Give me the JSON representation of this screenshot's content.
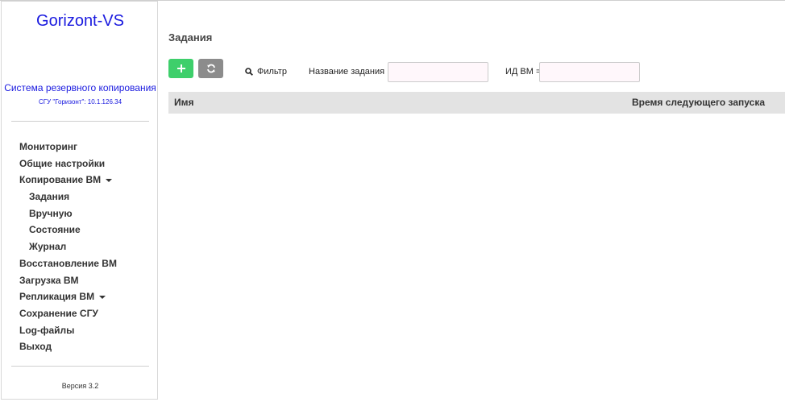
{
  "sidebar": {
    "brand": "Gorizont-VS",
    "subtitle": "Система резервного копирования",
    "host_line": "СГУ \"Горизонт\": 10.1.126.34",
    "menu": [
      {
        "label": "Мониторинг"
      },
      {
        "label": "Общие настройки"
      },
      {
        "label": "Копирование ВМ",
        "expandable": true
      },
      {
        "label": "Задания",
        "sub": true
      },
      {
        "label": "Вручную",
        "sub": true
      },
      {
        "label": "Состояние",
        "sub": true
      },
      {
        "label": "Журнал",
        "sub": true
      },
      {
        "label": "Восстановление ВМ"
      },
      {
        "label": "Загрузка ВМ"
      },
      {
        "label": "Репликация ВМ",
        "expandable": true
      },
      {
        "label": "Сохранение СГУ"
      },
      {
        "label": "Log-файлы"
      },
      {
        "label": "Выход"
      }
    ],
    "version": "Версия 3.2"
  },
  "main": {
    "title": "Задания",
    "toolbar": {
      "add_icon": "plus-icon",
      "refresh_icon": "refresh-icon",
      "filter_label": "Фильтр",
      "task_name_label": "Название задания",
      "task_name_value": "",
      "vm_id_label": "ИД ВМ =",
      "vm_id_value": ""
    },
    "table": {
      "columns": [
        "Имя",
        "Время следующего запуска"
      ],
      "rows": []
    }
  },
  "colors": {
    "brand": "#1a1adf",
    "add_button": "#3ecf6b",
    "refresh_button": "#8c8c8c",
    "table_header": "#e3e3e3",
    "input_bg": "#fff7fb"
  }
}
